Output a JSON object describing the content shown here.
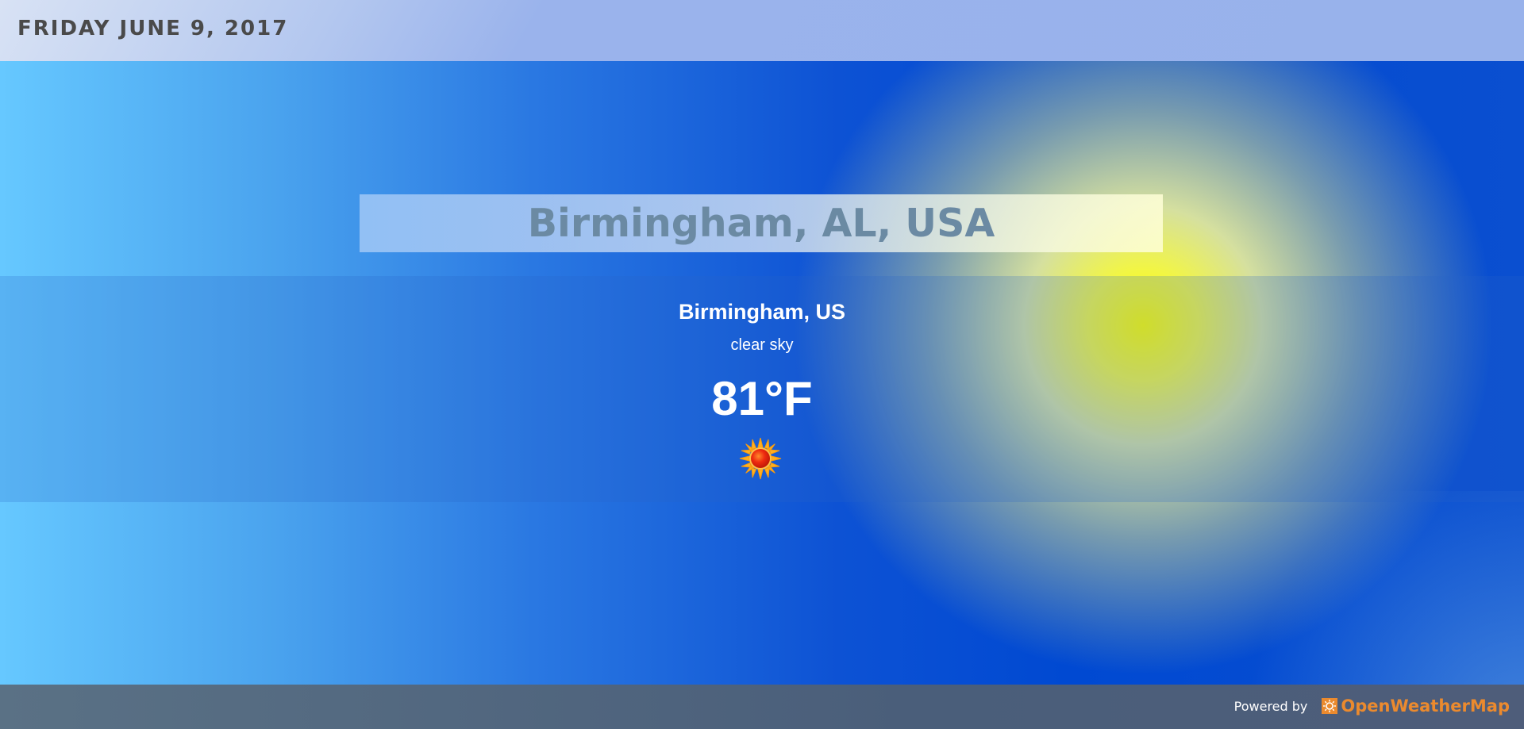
{
  "header": {
    "date": "FRIDAY JUNE 9, 2017"
  },
  "banner": {
    "city": "Birmingham, AL, USA"
  },
  "weather": {
    "location": "Birmingham, US",
    "description": "clear sky",
    "temperature": "81°F",
    "icon": "sun-icon"
  },
  "footer": {
    "powered_by": "Powered by",
    "provider": "OpenWeatherMap",
    "provider_icon": "openweathermap-logo-icon"
  },
  "colors": {
    "provider_accent": "#eb8a2e",
    "sun_glow": "#ffff00",
    "sky_blue": "#0049d2"
  }
}
